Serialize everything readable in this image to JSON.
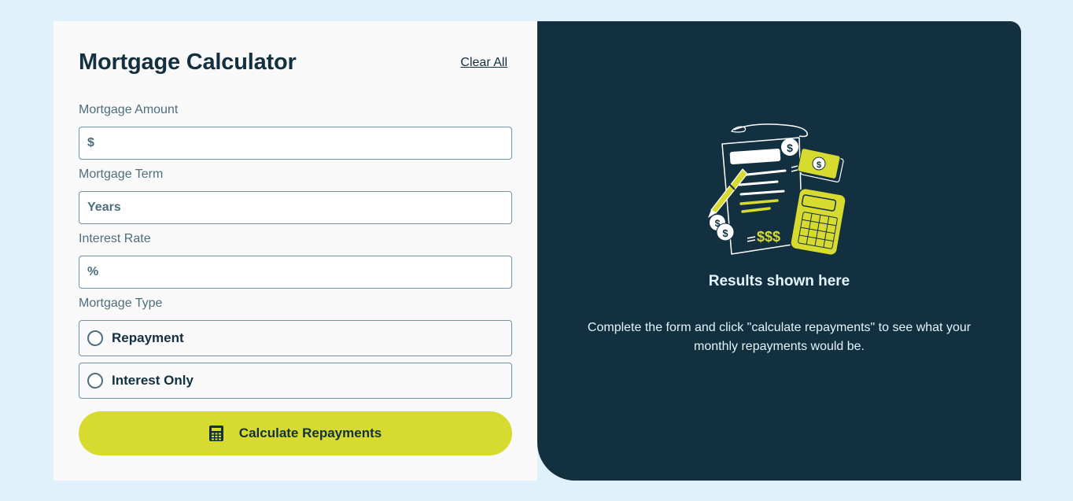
{
  "form": {
    "title": "Mortgage Calculator",
    "clear_all": "Clear All",
    "amount": {
      "label": "Mortgage Amount",
      "prefix": "$",
      "value": ""
    },
    "term": {
      "label": "Mortgage Term",
      "placeholder": "Years",
      "value": ""
    },
    "rate": {
      "label": "Interest Rate",
      "placeholder": "%",
      "value": ""
    },
    "type": {
      "label": "Mortgage Type",
      "options": [
        {
          "label": "Repayment",
          "selected": false
        },
        {
          "label": "Interest Only",
          "selected": false
        }
      ]
    },
    "submit": {
      "label": "Calculate Repayments",
      "icon": "calculator-icon"
    }
  },
  "results": {
    "illustration": "empty-results-illustration",
    "title": "Results shown here",
    "description": "Complete the form and click \"calculate repayments\" to see what your monthly repayments would be."
  },
  "colors": {
    "page_bg": "#e1f1fc",
    "panel_bg": "#f9f9f9",
    "results_bg": "#133041",
    "accent_lime": "#d8db2f",
    "text_dark": "#133041",
    "text_muted": "#4e6e7e",
    "border": "#6b94a8"
  }
}
